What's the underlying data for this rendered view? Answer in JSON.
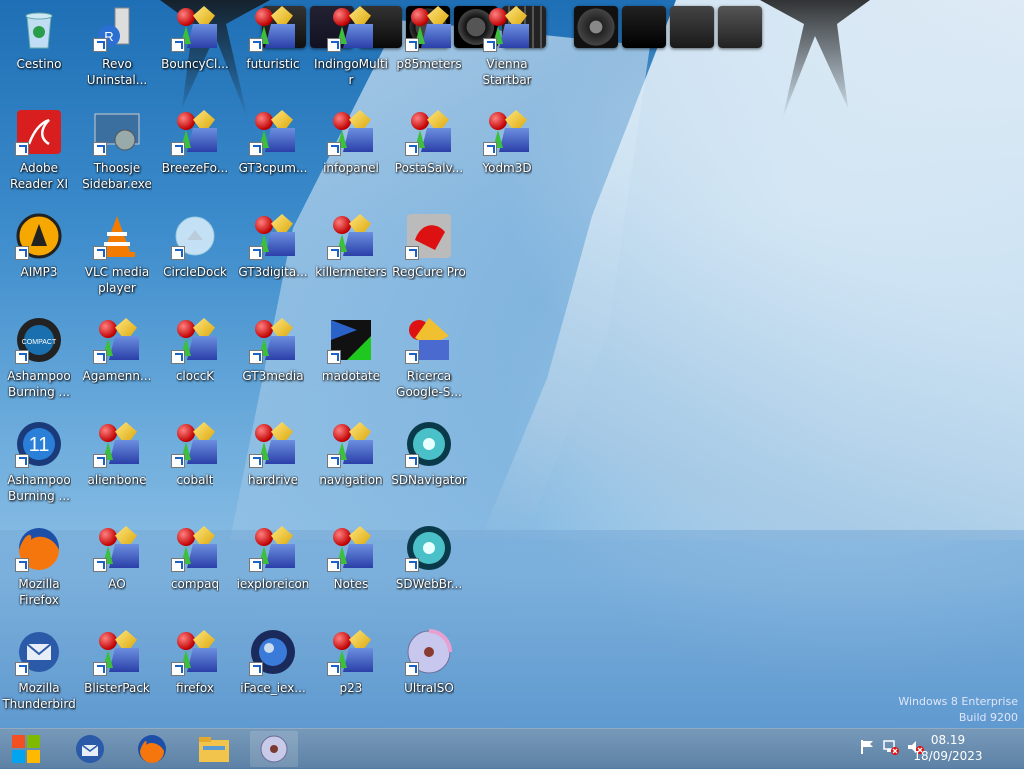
{
  "desktop": {
    "icons": [
      {
        "label": "Cestino"
      },
      {
        "label": "Revo\nUninstal..."
      },
      {
        "label": "BouncyCl..."
      },
      {
        "label": "futuristic"
      },
      {
        "label": "IndingoMultir"
      },
      {
        "label": "p85meters"
      },
      {
        "label": "Vienna\nStartbar"
      },
      {
        "label": "Adobe\nReader XI"
      },
      {
        "label": "Thoosje\nSidebar.exe"
      },
      {
        "label": "BreezeFo..."
      },
      {
        "label": "GT3cpum..."
      },
      {
        "label": "infopanel"
      },
      {
        "label": "PostaSalv..."
      },
      {
        "label": "Yodm3D"
      },
      {
        "label": "AIMP3"
      },
      {
        "label": "VLC media\nplayer"
      },
      {
        "label": "CircleDock"
      },
      {
        "label": "GT3digita..."
      },
      {
        "label": "killermeters"
      },
      {
        "label": "RegCure Pro"
      },
      {
        "label": "Ashampoo\nBurning ..."
      },
      {
        "label": "Agamenn..."
      },
      {
        "label": "cloccK"
      },
      {
        "label": "GT3media"
      },
      {
        "label": "madotate"
      },
      {
        "label": "Ricerca\nGoogle-S..."
      },
      {
        "label": "Ashampoo\nBurning ..."
      },
      {
        "label": "alienbone"
      },
      {
        "label": "cobalt"
      },
      {
        "label": "hardrive"
      },
      {
        "label": "navigation"
      },
      {
        "label": "SDNavigator"
      },
      {
        "label": "Mozilla\nFirefox"
      },
      {
        "label": "AO"
      },
      {
        "label": "compaq"
      },
      {
        "label": "iexploreicon"
      },
      {
        "label": "Notes"
      },
      {
        "label": "SDWebBr..."
      },
      {
        "label": "Mozilla\nThunderbird"
      },
      {
        "label": "BlisterPack"
      },
      {
        "label": "firefox"
      },
      {
        "label": "iFace_iex..."
      },
      {
        "label": "p23"
      },
      {
        "label": "UltraISO"
      }
    ]
  },
  "watermark": {
    "line1": "Windows 8 Enterprise",
    "line2": "Build 9200"
  },
  "clock": {
    "time": "08.19",
    "date": "18/09/2023"
  },
  "colors": {
    "taskbar": "#6f8fae",
    "label_text": "#ffffff"
  }
}
